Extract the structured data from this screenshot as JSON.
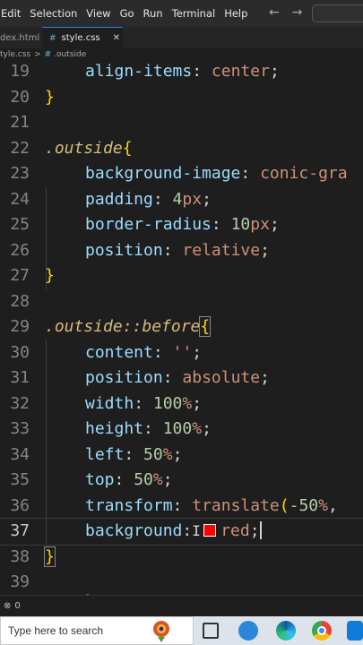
{
  "menu": [
    "Edit",
    "Selection",
    "View",
    "Go",
    "Run",
    "Terminal",
    "Help"
  ],
  "nav": {
    "back_icon": "arrow-left-icon",
    "forward_icon": "arrow-right-icon",
    "back": "←",
    "forward": "→"
  },
  "tabs": [
    {
      "label": "dex.html",
      "active": false
    },
    {
      "label": "style.css",
      "active": true,
      "icon": "css-file-icon",
      "icon_glyph": "#",
      "close": "✕"
    }
  ],
  "breadcrumb": {
    "file": "tyle.css",
    "separator": ">",
    "css_glyph": "#",
    "selector": ".outside"
  },
  "editor": {
    "lines": [
      {
        "n": "19",
        "tokens": [
          {
            "ind": 1
          },
          {
            "t": "align-items",
            "c": "prop"
          },
          {
            "t": ": ",
            "c": "punc"
          },
          {
            "t": "center",
            "c": "val"
          },
          {
            "t": ";",
            "c": "punc"
          }
        ]
      },
      {
        "n": "20",
        "tokens": [
          {
            "t": "}",
            "c": "brace"
          }
        ]
      },
      {
        "n": "21",
        "tokens": []
      },
      {
        "n": "22",
        "tokens": [
          {
            "t": ".outside",
            "c": "sel"
          },
          {
            "t": "{",
            "c": "brace"
          }
        ]
      },
      {
        "n": "23",
        "tokens": [
          {
            "ind": 1
          },
          {
            "t": "background-image",
            "c": "prop"
          },
          {
            "t": ": ",
            "c": "punc"
          },
          {
            "t": "conic-gra",
            "c": "val"
          }
        ]
      },
      {
        "n": "24",
        "tokens": [
          {
            "ind": 1
          },
          {
            "t": "padding",
            "c": "prop"
          },
          {
            "t": ": ",
            "c": "punc"
          },
          {
            "t": "4",
            "c": "num"
          },
          {
            "t": "px",
            "c": "val"
          },
          {
            "t": ";",
            "c": "punc"
          }
        ]
      },
      {
        "n": "25",
        "tokens": [
          {
            "ind": 1
          },
          {
            "t": "border-radius",
            "c": "prop"
          },
          {
            "t": ": ",
            "c": "punc"
          },
          {
            "t": "10",
            "c": "num"
          },
          {
            "t": "px",
            "c": "val"
          },
          {
            "t": ";",
            "c": "punc"
          }
        ]
      },
      {
        "n": "26",
        "tokens": [
          {
            "ind": 1
          },
          {
            "t": "position",
            "c": "prop"
          },
          {
            "t": ": ",
            "c": "punc"
          },
          {
            "t": "relative",
            "c": "val"
          },
          {
            "t": ";",
            "c": "punc"
          }
        ]
      },
      {
        "n": "27",
        "tokens": [
          {
            "t": "}",
            "c": "brace"
          }
        ]
      },
      {
        "n": "28",
        "tokens": []
      },
      {
        "n": "29",
        "tokens": [
          {
            "t": ".outside::before",
            "c": "sel"
          },
          {
            "t": "{",
            "c": "brace-m"
          }
        ]
      },
      {
        "n": "30",
        "tokens": [
          {
            "ind": 1
          },
          {
            "t": "content",
            "c": "prop"
          },
          {
            "t": ": ",
            "c": "punc"
          },
          {
            "t": "''",
            "c": "val"
          },
          {
            "t": ";",
            "c": "punc"
          }
        ]
      },
      {
        "n": "31",
        "tokens": [
          {
            "ind": 1
          },
          {
            "t": "position",
            "c": "prop"
          },
          {
            "t": ": ",
            "c": "punc"
          },
          {
            "t": "absolute",
            "c": "val"
          },
          {
            "t": ";",
            "c": "punc"
          }
        ]
      },
      {
        "n": "32",
        "tokens": [
          {
            "ind": 1
          },
          {
            "t": "width",
            "c": "prop"
          },
          {
            "t": ": ",
            "c": "punc"
          },
          {
            "t": "100",
            "c": "num"
          },
          {
            "t": "%",
            "c": "val"
          },
          {
            "t": ";",
            "c": "punc"
          }
        ]
      },
      {
        "n": "33",
        "tokens": [
          {
            "ind": 1
          },
          {
            "t": "height",
            "c": "prop"
          },
          {
            "t": ": ",
            "c": "punc"
          },
          {
            "t": "100",
            "c": "num"
          },
          {
            "t": "%",
            "c": "val"
          },
          {
            "t": ";",
            "c": "punc"
          }
        ]
      },
      {
        "n": "34",
        "tokens": [
          {
            "ind": 1
          },
          {
            "t": "left",
            "c": "prop"
          },
          {
            "t": ": ",
            "c": "punc"
          },
          {
            "t": "50",
            "c": "num"
          },
          {
            "t": "%",
            "c": "val"
          },
          {
            "t": ";",
            "c": "punc"
          }
        ]
      },
      {
        "n": "35",
        "tokens": [
          {
            "ind": 1
          },
          {
            "t": "top",
            "c": "prop"
          },
          {
            "t": ": ",
            "c": "punc"
          },
          {
            "t": "50",
            "c": "num"
          },
          {
            "t": "%",
            "c": "val"
          },
          {
            "t": ";",
            "c": "punc"
          }
        ]
      },
      {
        "n": "36",
        "tokens": [
          {
            "ind": 1
          },
          {
            "t": "transform",
            "c": "prop"
          },
          {
            "t": ": ",
            "c": "punc"
          },
          {
            "t": "translate",
            "c": "val"
          },
          {
            "t": "(",
            "c": "brace"
          },
          {
            "t": "-50",
            "c": "num"
          },
          {
            "t": "%",
            "c": "val"
          },
          {
            "t": ",",
            "c": "punc"
          }
        ]
      },
      {
        "n": "37",
        "active": true,
        "tokens": [
          {
            "ind": 1
          },
          {
            "t": "background",
            "c": "prop"
          },
          {
            "t": ":",
            "c": "punc"
          },
          {
            "ibeam": true
          },
          {
            "swatch": "#ff0000"
          },
          {
            "t": "red",
            "c": "val"
          },
          {
            "t": ";",
            "c": "punc"
          },
          {
            "cursor": true
          }
        ]
      },
      {
        "n": "38",
        "tokens": [
          {
            "t": "}",
            "c": "brace-m"
          }
        ]
      },
      {
        "n": "39",
        "tokens": []
      }
    ],
    "partial_line_text": "  {"
  },
  "status": {
    "icon": "error-count-icon",
    "text": "0"
  },
  "taskbar": {
    "search_placeholder": "Type here to search",
    "icons": [
      "flower-app-icon",
      "task-view-icon",
      "blue-app-icon",
      "edge-browser-icon",
      "chrome-browser-icon",
      "vscode-icon"
    ]
  },
  "colors": {
    "selector": "#d7ba7d",
    "property": "#9cdcfe",
    "value": "#ce9178",
    "number": "#b5cea8",
    "brace": "#ffd700",
    "swatch": "#ff0000"
  }
}
